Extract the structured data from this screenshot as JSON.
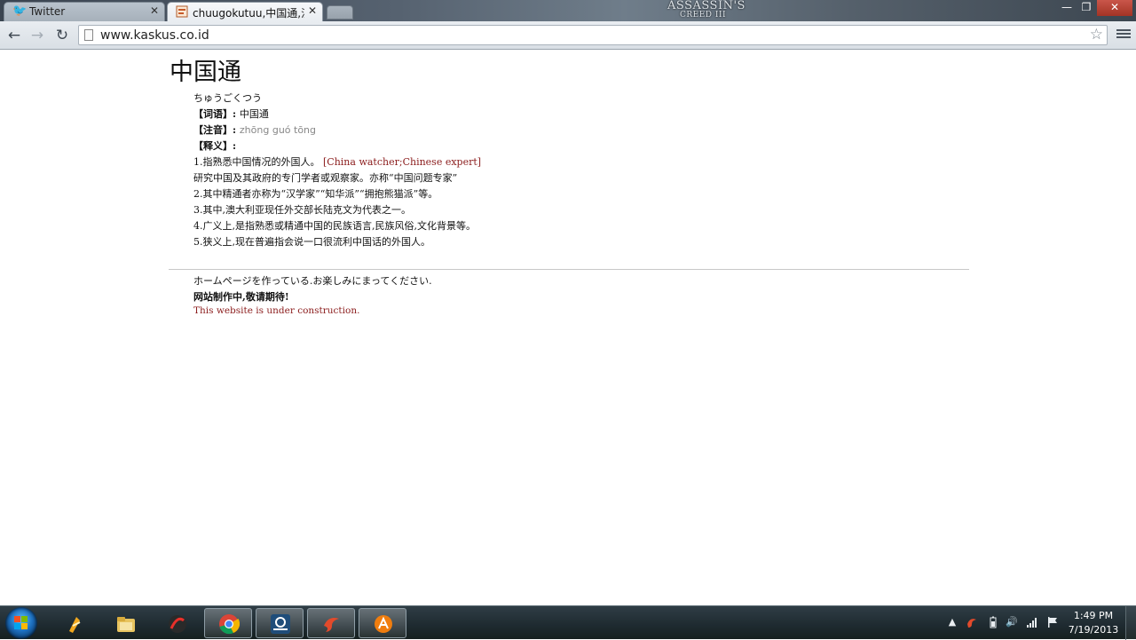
{
  "browser": {
    "tabs": [
      {
        "title": "Twitter",
        "favicon": "twitter-bird-icon",
        "active": false
      },
      {
        "title": "chuugokutuu,中国通,汉语",
        "favicon": "page-favicon",
        "active": true
      }
    ],
    "brand_logo_line1": "ASSASSIN'S",
    "brand_logo_line2": "CREED III",
    "address": "www.kaskus.co.id",
    "window_controls": {
      "minimize": "—",
      "maximize": "❐",
      "close": "✕"
    }
  },
  "page": {
    "heading": "中国通",
    "reading": "ちゅうごくつう",
    "word_label": "【词语】:",
    "word_value": "中国通",
    "phonetic_label": "【注音】:",
    "phonetic_value": "zhōng guó tōng",
    "meaning_label": "【释义】:",
    "def1_text": "1.指熟悉中国情况的外国人。",
    "def1_english": "[China watcher;Chinese expert]",
    "def1_cont": "研究中国及其政府的专门学者或观察家。亦称“中国问题专家”",
    "def2": "2.其中精通者亦称为“汉学家”“知华派”“拥抱熊猫派”等。",
    "def3": "3.其中,澳大利亚现任外交部长陆克文为代表之一。",
    "def4": "4.广义上,是指熟悉或精通中国的民族语言,民族风俗,文化背景等。",
    "def5": "5.狭义上,现在普遍指会说一口很流利中国话的外国人。",
    "construction_jp": "ホームページを作っている.お楽しみにまってください.",
    "construction_cn": "网站制作中,敬请期待!",
    "construction_en": "This website is under construction."
  },
  "taskbar": {
    "apps": [
      {
        "name": "winamp",
        "open": false
      },
      {
        "name": "file-explorer",
        "open": false
      },
      {
        "name": "media-app",
        "open": false
      },
      {
        "name": "chrome",
        "open": true
      },
      {
        "name": "steam",
        "open": true
      },
      {
        "name": "flash-app",
        "open": true
      },
      {
        "name": "avast",
        "open": true
      }
    ],
    "time": "1:49 PM",
    "date": "7/19/2013"
  },
  "colors": {
    "accent_red": "#8b1c1c",
    "phonetic_gray": "#888888",
    "taskbar_bg": "#1e2a30"
  }
}
